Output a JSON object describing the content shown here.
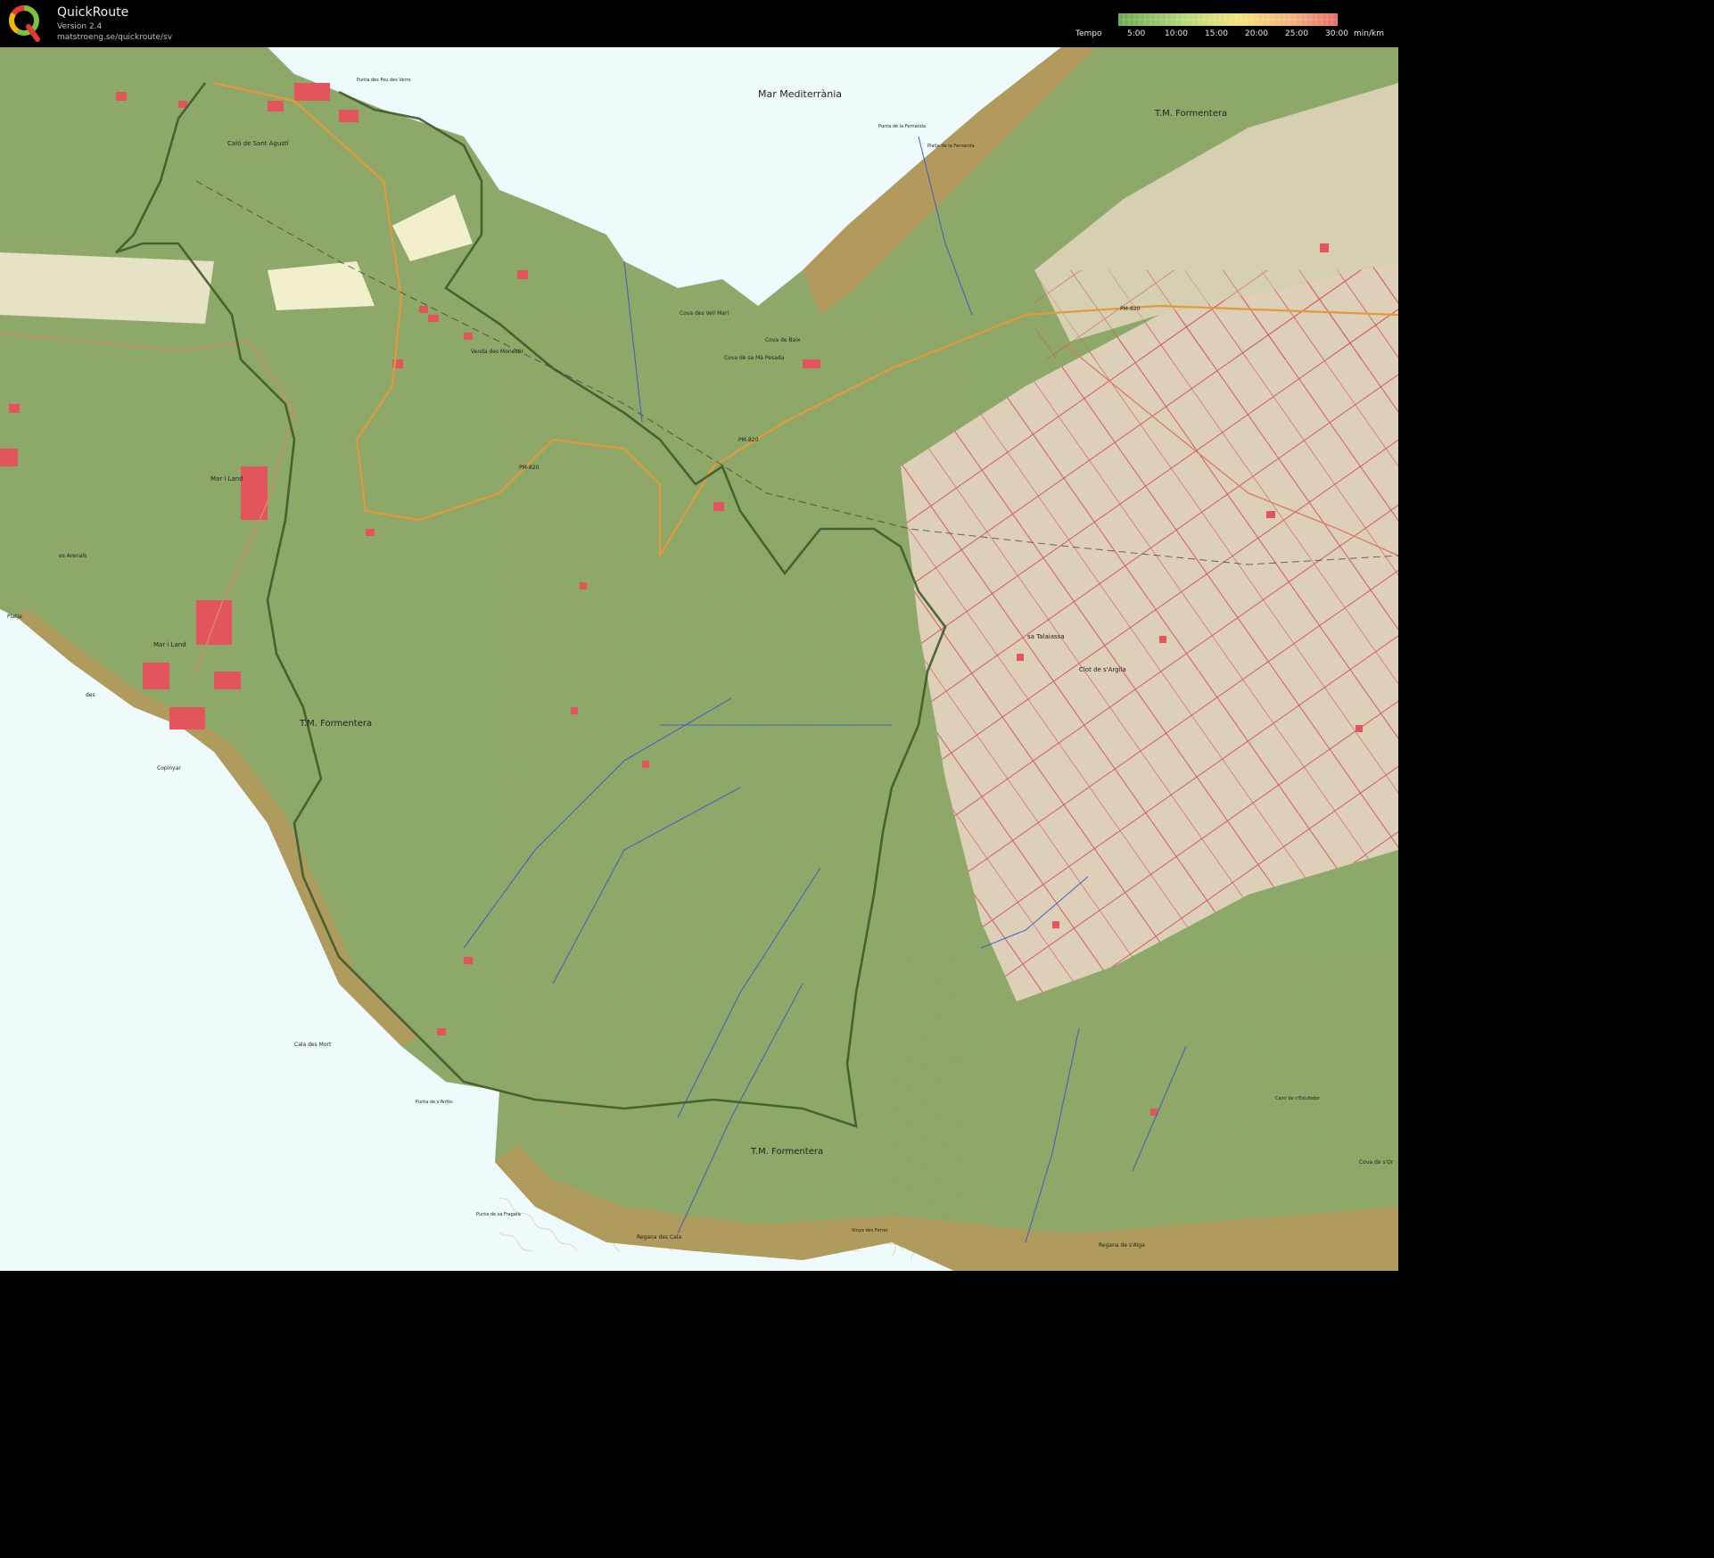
{
  "app": {
    "title": "QuickRoute",
    "version": "Version 2.4",
    "url": "matstroeng.se/quickroute/sv"
  },
  "legend": {
    "label": "Tempo",
    "ticks": [
      "5:00",
      "10:00",
      "15:00",
      "20:00",
      "25:00",
      "30:00"
    ],
    "unit": "min/km",
    "gradient_colors": [
      "#6aa84f",
      "#b6d77a",
      "#f4e27a",
      "#f3b07a",
      "#e66a6a"
    ]
  },
  "map": {
    "labels": {
      "sea": "Mar Mediterrània",
      "tm1": "T.M. Formentera",
      "tm2": "T.M. Formentera",
      "tm3": "T.M. Formentera",
      "calo": "Caló de Sant Agustí",
      "mar_land": "Mar i Land",
      "mar_land2": "Mar i Land",
      "es_arenals": "es Arenals",
      "cova_vell_mari": "Cova des Vell Marí",
      "cova_sa_mapesada": "Cova de sa Mà Pesada",
      "cova_baix": "Cova de Baix",
      "venda_monestir": "Venda des Monestir",
      "sa_talaiassa": "sa Talaiassa",
      "clot_argila": "Clot de s'Argila",
      "pm820a": "PM-820",
      "pm820b": "PM-820",
      "pm820c": "PM-820",
      "punta_pou": "Punta des Pou des Verro",
      "punta_fernanda": "Punta de la Fernanda",
      "platja_fernanda": "Platja de la Fernanda",
      "punta_fragata": "Punta de sa Fragata",
      "punta_anfos": "Punta de s'Anfós",
      "regana_cala": "Regana des Cala",
      "regana_alga": "Regana de s'Alga",
      "platja": "Platja",
      "des": "des",
      "copinyar": "Copinyar",
      "cala_mort": "Cala des Mort",
      "vinya": "Vinya des Ferrer",
      "cova_dor": "Cova de s'Or",
      "cami_salvador": "Camí de s'Estufador"
    }
  }
}
